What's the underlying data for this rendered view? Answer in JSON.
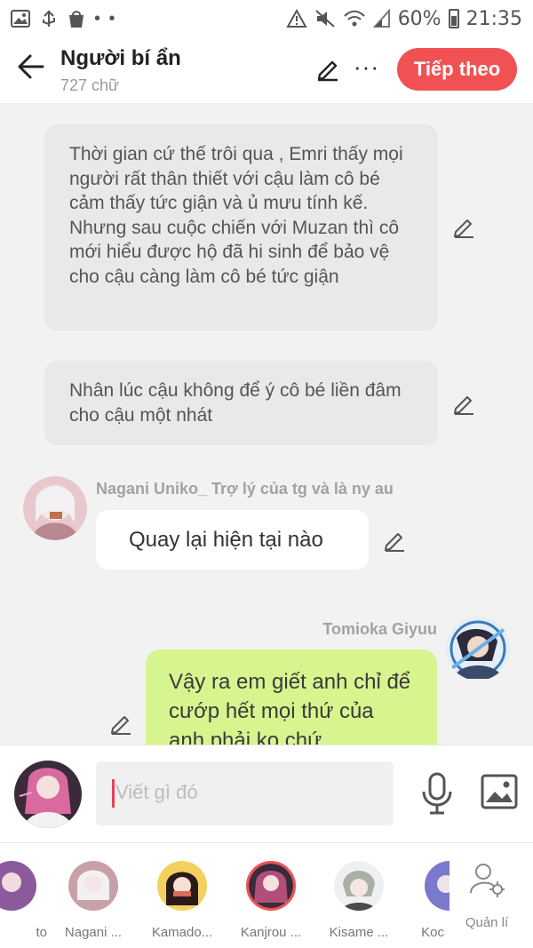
{
  "status_bar": {
    "battery": "60%",
    "time": "21:35",
    "left_icons": [
      "gallery-icon",
      "usb-icon",
      "bag-icon"
    ],
    "right_icons": [
      "alert-icon",
      "mute-icon",
      "wifi-icon",
      "signal-icon",
      "battery-icon"
    ]
  },
  "header": {
    "title": "Người bí ẩn",
    "subtitle": "727 chữ",
    "next_label": "Tiếp theo",
    "more_label": "···"
  },
  "messages": {
    "narration_1": "Thời gian cứ thế trôi qua , Emri thấy mọi người rất thân thiết với cậu làm cô bé cảm thấy tức giận và ủ mưu tính kế. Nhưng sau cuộc chiến với Muzan thì cô mới hiểu được hộ đã hi sinh để bảo vệ cho cậu càng làm cô bé tức giận",
    "narration_2": "Nhân lúc cậu không để ý cô bé liền đâm cho cậu một nhát",
    "left_name": "Nagani Uniko_ Trợ lý của tg và là ny au",
    "left_text": "Quay lại hiện tại nào",
    "right_name": "Tomioka Giyuu",
    "right_text": "Vậy ra em giết anh chỉ để cướp hết mọi thứ của anh phải ko chứ"
  },
  "input": {
    "placeholder": "Viết gì đó"
  },
  "characters": [
    {
      "label": "to",
      "color": "#8a5a9a"
    },
    {
      "label": "Nagani ...",
      "color": "#c8a0a8"
    },
    {
      "label": "Kamado...",
      "color": "#d86b5c"
    },
    {
      "label": "Kanjrou ...",
      "color": "#b0507a"
    },
    {
      "label": "Kisame ...",
      "color": "#a8b0a8"
    },
    {
      "label": "Koc",
      "color": "#7a7acc"
    }
  ],
  "manage_label": "Quản lí",
  "colors": {
    "accent": "#f05254",
    "user_bubble": "#d6f58f",
    "narration_bg": "#e9e9e9",
    "background": "#f2f2f2"
  }
}
